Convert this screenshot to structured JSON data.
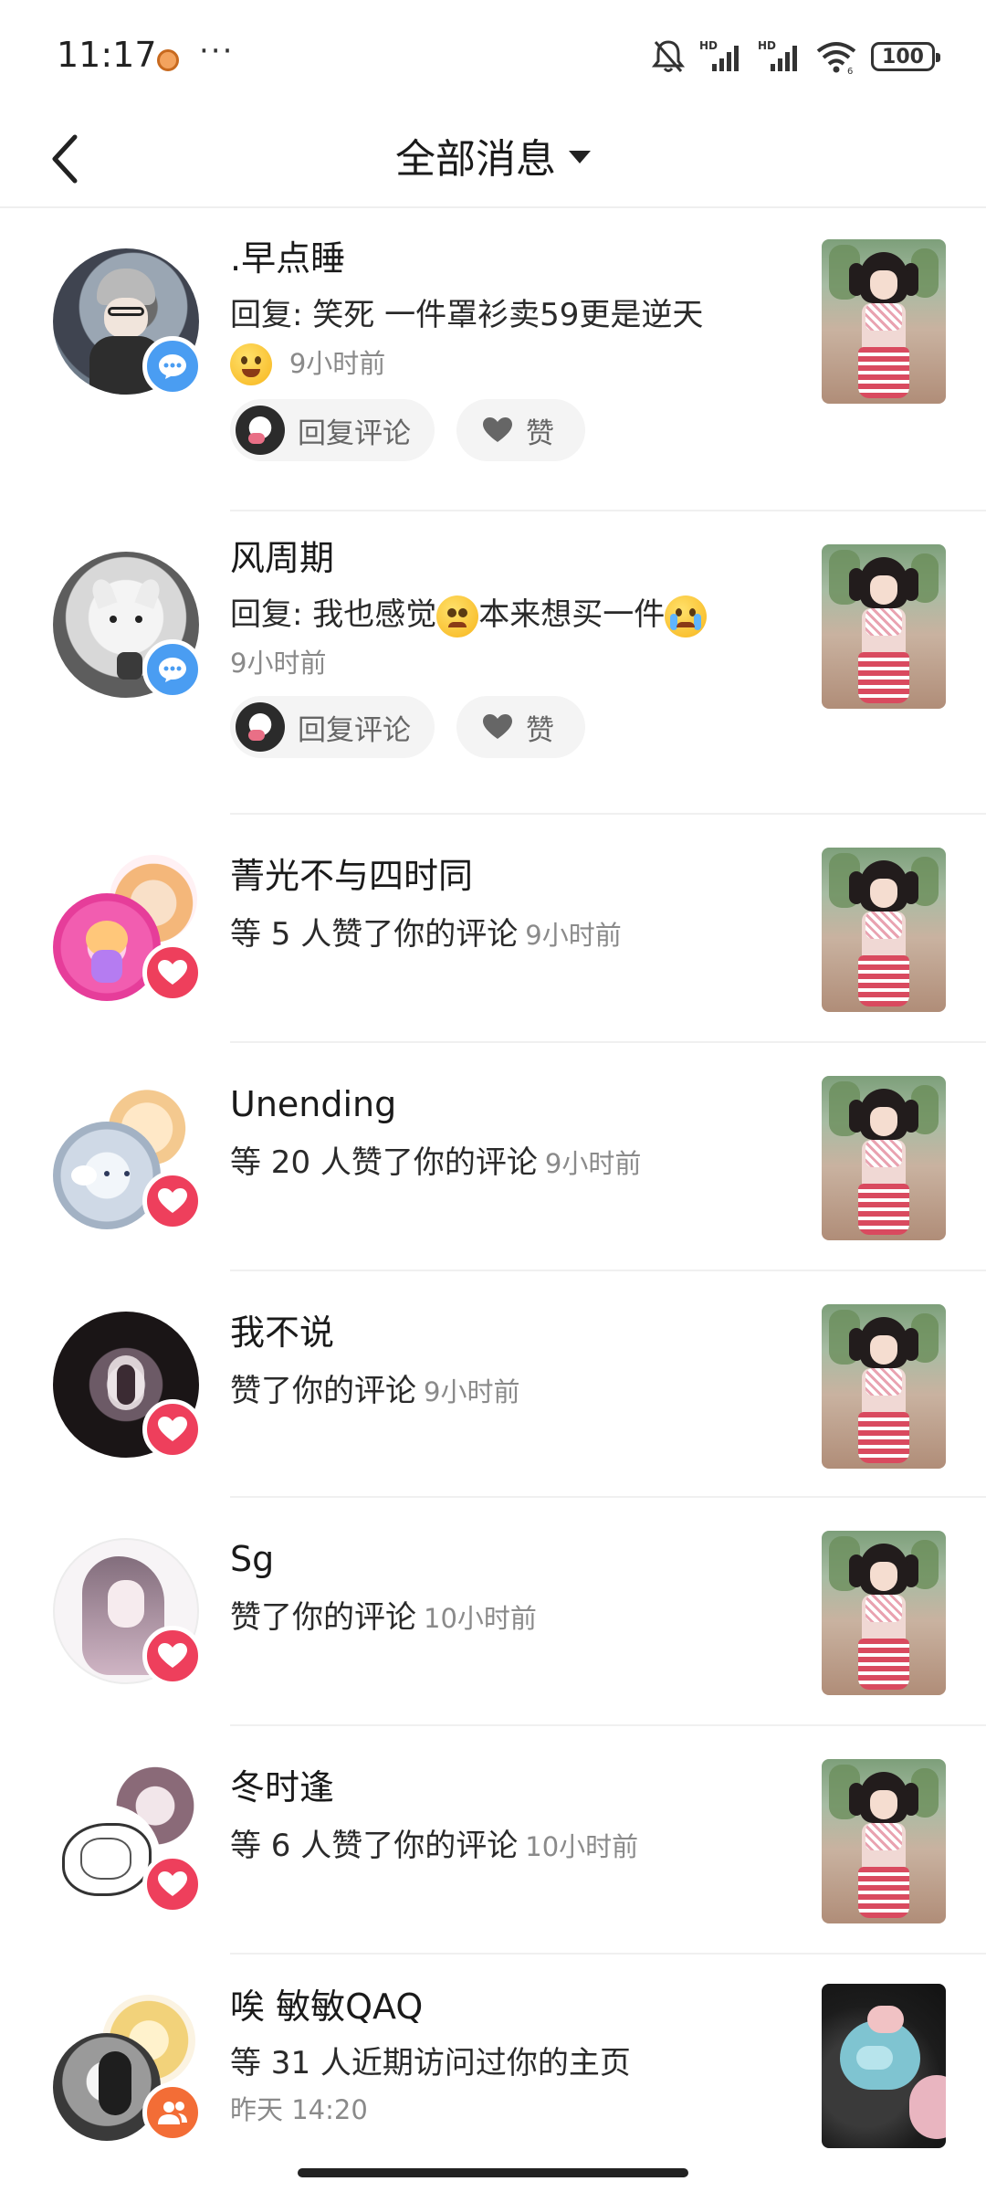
{
  "status_bar": {
    "time": "11:17",
    "more": "···",
    "battery": "100",
    "network_label": "HD",
    "wifi_sub": "6",
    "icons": [
      "mute-icon",
      "signal-icon",
      "signal-icon",
      "wifi-icon",
      "battery-icon"
    ]
  },
  "header": {
    "back_icon": "chevron-left-icon",
    "title": "全部消息",
    "dropdown_icon": "caret-down-icon"
  },
  "colors": {
    "comment_badge": "#4a9df2",
    "like_badge": "#ee3f5c",
    "visit_badge": "#f36d36",
    "secondary_text": "#8a8a8a",
    "pill_bg": "#f4f4f4"
  },
  "messages": [
    {
      "type": "comment_reply",
      "name": ".早点睡",
      "text": "回复: 笑死 一件罩衫卖59更是逆天",
      "emoji": "grinning-tongue-emoji",
      "time": "9小时前",
      "badge_icon": "comment-bubble-icon",
      "actions": {
        "reply": "回复评论",
        "like": "赞"
      }
    },
    {
      "type": "comment_reply",
      "name": "风周期",
      "text_before": "回复: 我也感觉",
      "emoji_mid": "pleading-face-emoji",
      "text_after": "本来想买一件",
      "emoji_end": "loudly-crying-emoji",
      "time": "9小时前",
      "badge_icon": "comment-bubble-icon",
      "actions": {
        "reply": "回复评论",
        "like": "赞"
      }
    },
    {
      "type": "like",
      "name": "菁光不与四时同",
      "text": "等 5 人赞了你的评论",
      "time": "9小时前",
      "badge_icon": "heart-icon"
    },
    {
      "type": "like",
      "name": "Unending",
      "text": "等 20 人赞了你的评论",
      "time": "9小时前",
      "badge_icon": "heart-icon"
    },
    {
      "type": "like",
      "name": "我不说",
      "text": "赞了你的评论",
      "time": "9小时前",
      "badge_icon": "heart-icon"
    },
    {
      "type": "like",
      "name": "Sg",
      "text": "赞了你的评论",
      "time": "10小时前",
      "badge_icon": "heart-icon"
    },
    {
      "type": "like",
      "name": "冬时逢",
      "text": "等 6 人赞了你的评论",
      "time": "10小时前",
      "badge_icon": "heart-icon"
    },
    {
      "type": "visit",
      "name": "唉 敏敏QAQ",
      "text": "等 31 人近期访问过你的主页",
      "time": "昨天 14:20",
      "badge_icon": "people-icon"
    }
  ]
}
